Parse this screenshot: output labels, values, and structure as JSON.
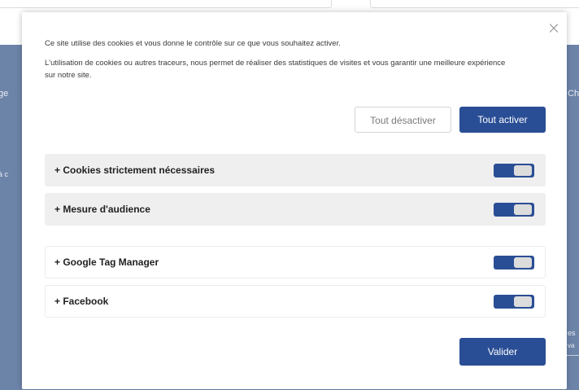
{
  "modal": {
    "close_symbol": "×",
    "intro_line1": "Ce site utilise des cookies et vous donne le contrôle sur ce que vous souhaitez activer.",
    "intro_line2": "L'utilisation de cookies ou autres traceurs, nous permet de réaliser des statistiques de visites et vous garantir une meilleure expérience sur notre site.",
    "disable_all_label": "Tout désactiver",
    "enable_all_label": "Tout activer",
    "categories": [
      {
        "label": "+ Cookies strictement nécessaires",
        "enabled": true
      },
      {
        "label": "+ Mesure d'audience",
        "enabled": true
      },
      {
        "label": "+ Google Tag Manager",
        "enabled": true
      },
      {
        "label": "+ Facebook",
        "enabled": true
      }
    ],
    "validate_label": "Valider"
  },
  "colors": {
    "primary": "#2a4e95",
    "background_overlay": "#6d84a9",
    "row_fill": "#efefef",
    "toggle_knob": "#dcdcdc"
  },
  "background_page": {
    "left_fragments": [
      "ge",
      "à c"
    ],
    "right_fragments": [
      "Ch",
      "es",
      "va"
    ]
  }
}
